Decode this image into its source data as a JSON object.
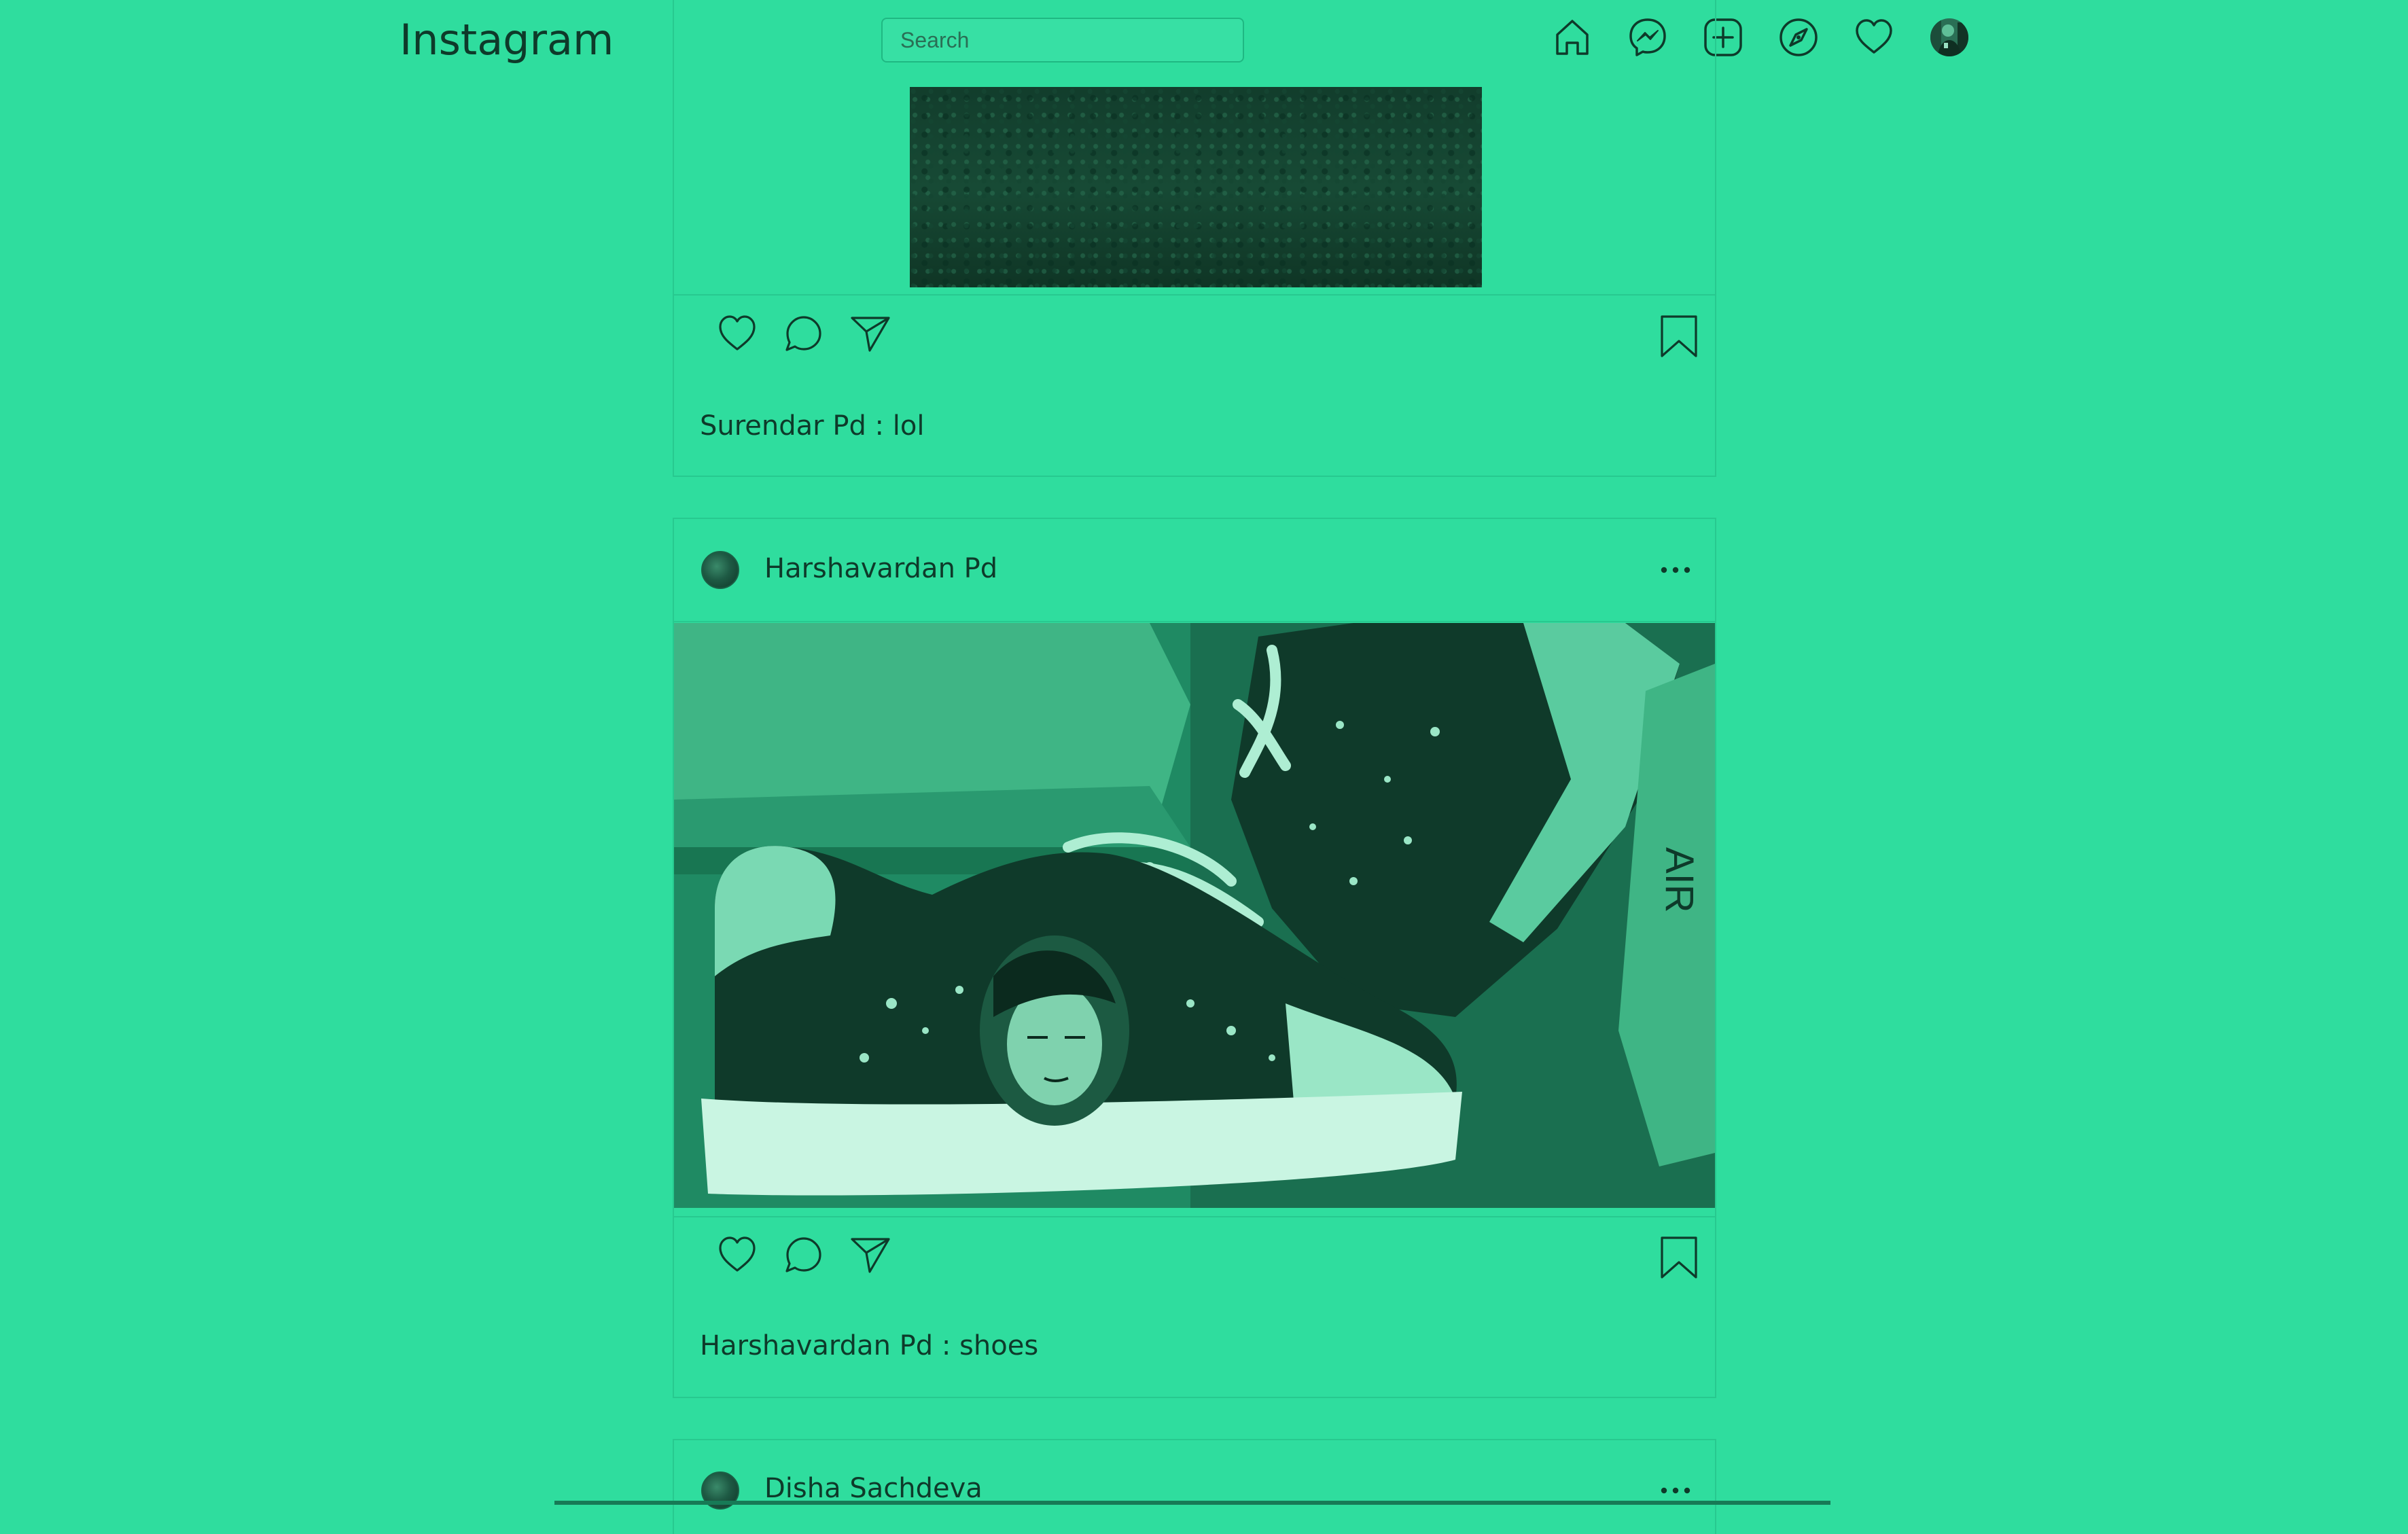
{
  "nav": {
    "logo": "Instagram",
    "search_placeholder": "Search",
    "icons": [
      "home-icon",
      "messenger-icon",
      "new-post-icon",
      "explore-icon",
      "activity-heart-icon",
      "profile-avatar"
    ]
  },
  "posts": [
    {
      "caption": "Surendar Pd : lol"
    },
    {
      "username": "Harshavardan Pd",
      "image_text": "AIR",
      "caption": "Harshavardan Pd : shoes"
    },
    {
      "username": "Disha Sachdeva"
    }
  ],
  "colors": {
    "background": "#2fdd9e",
    "text": "#0e3a2a",
    "border": "#27c98f"
  }
}
